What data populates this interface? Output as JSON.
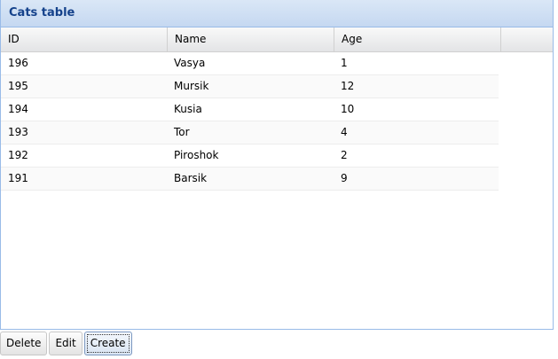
{
  "panel": {
    "title": "Cats table"
  },
  "grid": {
    "columns": [
      "ID",
      "Name",
      "Age"
    ],
    "rows": [
      {
        "id": "196",
        "name": "Vasya",
        "age": "1"
      },
      {
        "id": "195",
        "name": "Mursik",
        "age": "12"
      },
      {
        "id": "194",
        "name": "Kusia",
        "age": "10"
      },
      {
        "id": "193",
        "name": "Tor",
        "age": "4"
      },
      {
        "id": "192",
        "name": "Piroshok",
        "age": "2"
      },
      {
        "id": "191",
        "name": "Barsik",
        "age": "9"
      }
    ]
  },
  "toolbar": {
    "delete_label": "Delete",
    "edit_label": "Edit",
    "create_label": "Create"
  },
  "colors": {
    "header_text": "#15428b",
    "panel_border": "#99bbe8"
  }
}
